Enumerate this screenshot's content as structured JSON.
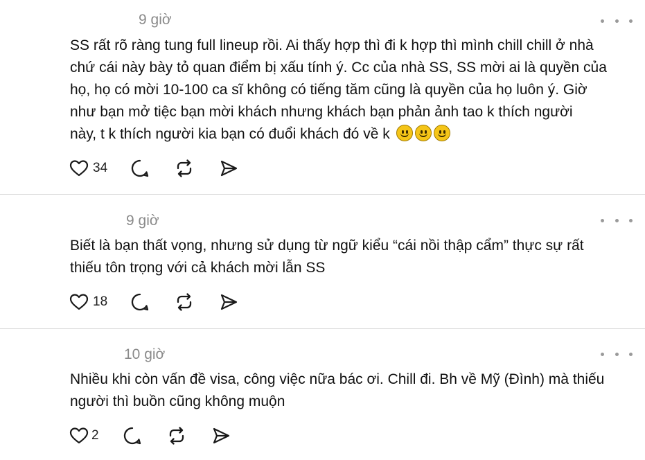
{
  "comments": [
    {
      "time": "9 giờ",
      "lines": [
        "SS rất rõ ràng tung full lineup rồi. Ai thấy hợp thì đi k hợp thì mình chill chill ở nhà",
        "chứ cái này bày tỏ quan điểm bị xấu tính ý. Cc của nhà SS, SS mời ai là quyền của",
        "họ, họ có mời 10-100 ca sĩ không có tiếng tăm cũng là quyền của họ luôn ý. Giờ",
        "như bạn mở tiệc bạn mời khách nhưng khách bạn phản ảnh tao k thích người",
        "này, t k thích người kia bạn có đuổi khách đó về k"
      ],
      "emoji": [
        "slightly-smiling-face-emoji",
        "slightly-smiling-face-emoji",
        "slightly-smiling-face-emoji"
      ],
      "likes": "34"
    },
    {
      "time": "9 giờ",
      "lines": [
        "Biết là bạn thất vọng, nhưng sử dụng từ ngữ kiểu “cái nồi thập cẩm” thực sự rất",
        "thiếu tôn trọng với cả khách mời lẫn SS"
      ],
      "likes": "18"
    },
    {
      "time": "10 giờ",
      "lines": [
        "Nhiều khi còn vấn đề visa, công việc nữa bác ơi. Chill đi. Bh về Mỹ (Đình) mà thiếu",
        "người thì buồn cũng không muộn"
      ],
      "likes": "2"
    }
  ],
  "icons": {
    "more": "more-options-icon",
    "like": "heart-icon",
    "reply": "comment-icon",
    "repost": "repost-icon",
    "share": "send-icon"
  },
  "colors": {
    "text": "#111111",
    "muted": "#8a8a8a",
    "divider": "#d9d9d9",
    "icon": "#1a1a1a"
  }
}
